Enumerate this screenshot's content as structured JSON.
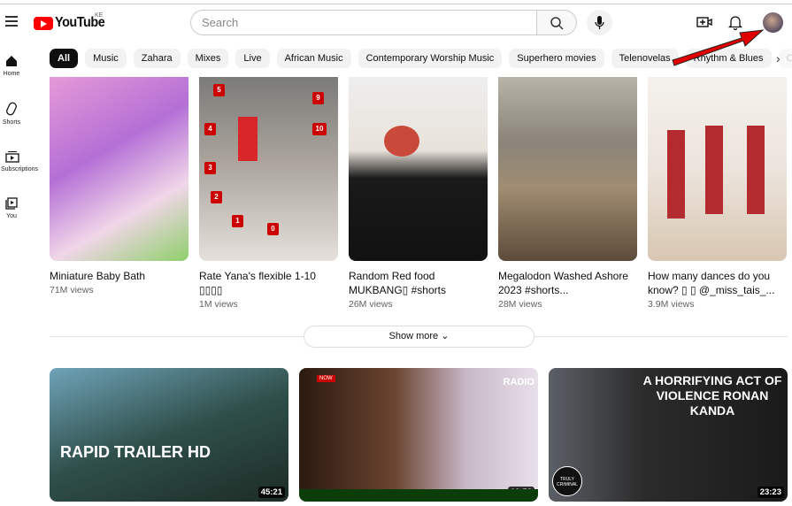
{
  "header": {
    "logo_text": "YouTube",
    "region": "KE",
    "search_placeholder": "Search"
  },
  "sidebar": [
    {
      "label": "Home",
      "icon": "home-icon"
    },
    {
      "label": "Shorts",
      "icon": "shorts-icon"
    },
    {
      "label": "Subscriptions",
      "icon": "subscriptions-icon"
    },
    {
      "label": "You",
      "icon": "you-icon"
    }
  ],
  "chips": [
    "All",
    "Music",
    "Zahara",
    "Mixes",
    "Live",
    "African Music",
    "Contemporary Worship Music",
    "Superhero movies",
    "Telenovelas",
    "Rhythm & Blues",
    "C"
  ],
  "shorts": [
    {
      "title": "Miniature Baby Bath",
      "views": "71M views"
    },
    {
      "title": "Rate Yana's flexible 1-10 ▯▯▯▯",
      "views": "1M views"
    },
    {
      "title": "Random Red food MUKBANG▯ #shorts",
      "views": "26M views"
    },
    {
      "title": "Megalodon Washed Ashore 2023 #shorts...",
      "views": "28M views"
    },
    {
      "title": "How many dances do you know? ▯ ▯ @_miss_tais_...",
      "views": "3.9M views"
    }
  ],
  "rank_badges": [
    "5",
    "4",
    "3",
    "2",
    "1",
    "9",
    "10",
    "0"
  ],
  "show_more": "Show more",
  "videos": [
    {
      "duration": "45:21",
      "overlay": "RAPID TRAILER HD"
    },
    {
      "duration": "16:53",
      "overlay": "RADIO",
      "tag": "NOW"
    },
    {
      "duration": "23:23",
      "overlay": "A HORRIFYING ACT OF VIOLENCE RONAN KANDA",
      "corner": "TRULY CRIMINAL"
    }
  ],
  "colors": {
    "brand": "#ff0000",
    "annotation_arrow": "#e00000"
  }
}
